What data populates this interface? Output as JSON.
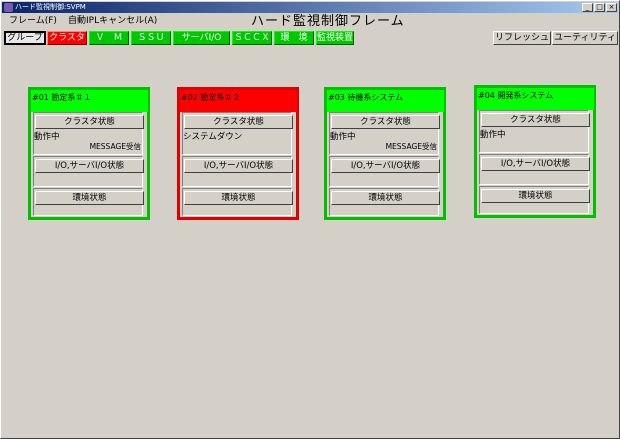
{
  "window": {
    "title": "ハード監視制御:SVPM",
    "controls": {
      "minimize": "_",
      "maximize": "□",
      "close": "×"
    }
  },
  "menu": {
    "items": [
      {
        "label": "フレーム(F)"
      },
      {
        "label": "自動IPLキャンセル(A)"
      }
    ]
  },
  "frame_title": "ハード監視制御フレーム",
  "toolbar": {
    "buttons": [
      {
        "label": "グループ",
        "state": "pressed"
      },
      {
        "label": "クラスタ",
        "state": "red"
      },
      {
        "label": "Ｖ　Ｍ",
        "state": "green"
      },
      {
        "label": "ＳＳＵ",
        "state": "green"
      },
      {
        "label": "サーバI/O",
        "state": "green"
      },
      {
        "label": "ＳＣＣＸ",
        "state": "green"
      },
      {
        "label": "環　境",
        "state": "green"
      },
      {
        "label": "監視装置",
        "state": "green"
      }
    ],
    "refresh_label": "リフレッシュ",
    "utility_label": "ユーティリティ"
  },
  "colors": {
    "ok": "#00ff00",
    "error": "#ff0000",
    "border_ok": "#00c000",
    "border_error": "#e00000"
  },
  "panels": [
    {
      "title": "#01 勘定系＃１",
      "state": "ok",
      "cluster_button": "クラスタ状態",
      "status": "動作中",
      "message": "MESSAGE受信",
      "io_button": "I/O,サーバI/O状態",
      "env_button": "環境状態"
    },
    {
      "title": "#02 勘定系＃２",
      "state": "error",
      "cluster_button": "クラスタ状態",
      "status": "システムダウン",
      "message": "",
      "io_button": "I/O,サーバI/O状態",
      "env_button": "環境状態"
    },
    {
      "title": "#03 待機系システム",
      "state": "ok",
      "cluster_button": "クラスタ状態",
      "status": "動作中",
      "message": "MESSAGE受信",
      "io_button": "I/O,サーバI/O状態",
      "env_button": "環境状態"
    },
    {
      "title": "#04 開発系システム",
      "state": "ok",
      "cluster_button": "クラスタ状態",
      "status": "動作中",
      "message": "",
      "io_button": "I/O,サーバI/O状態",
      "env_button": "環境状態"
    }
  ]
}
